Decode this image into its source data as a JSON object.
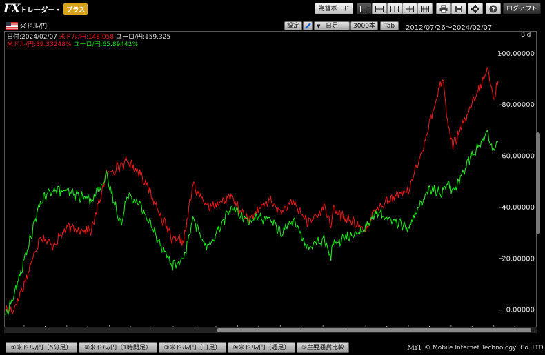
{
  "app": {
    "logo_fx": "FX",
    "logo_trader": "トレーダー・",
    "logo_plus": "プラス"
  },
  "toolbar": {
    "rate_board": "為替ボード",
    "logout": "ログアウト",
    "icons": [
      "layout-single-icon",
      "layout-rows-icon",
      "layout-columns-icon",
      "layout-quad-icon",
      "layout-grid-icon",
      "print-icon",
      "save-icon",
      "settings-icon",
      "help-icon"
    ]
  },
  "panel": {
    "pair": "米ドル/円",
    "settings_button": "設定",
    "interval": "日足",
    "bars": "3000本",
    "tab_button": "Tab",
    "date_range": "2012/07/26～2024/02/07"
  },
  "info": {
    "date_label": "日付:2024/02/07",
    "usd_price_label": "米ドル/円:148.058",
    "eur_price_label": "ユーロ/円:159.325",
    "usd_change_label": "米ドル/円:89.33248%",
    "eur_change_label": "ユーロ/円:65.89442%",
    "price_type": "Bid"
  },
  "chart_data": {
    "type": "line",
    "title": "",
    "ylabel": "",
    "y_unit": "%",
    "ylim": [
      -6,
      108
    ],
    "y_ticks": [
      "100.00000",
      "80.00000",
      "60.00000",
      "40.00000",
      "20.00000",
      "0.00000"
    ],
    "x_ticks": [
      "2013年",
      "2014年",
      "2015年",
      "2016年",
      "2017年",
      "2018年",
      "2019年",
      "2020年",
      "2021年",
      "2022年",
      "2023年",
      "2024年"
    ],
    "x_start": "2012-07-26",
    "x_end": "2024-02-07",
    "series": [
      {
        "name": "米ドル/円",
        "color": "#e01818",
        "x": [
          "2012-07-26",
          "2012-10-01",
          "2013-01-01",
          "2013-05-20",
          "2013-09-01",
          "2014-01-02",
          "2014-08-01",
          "2014-12-05",
          "2015-06-05",
          "2015-10-01",
          "2016-06-24",
          "2016-09-27",
          "2016-12-15",
          "2017-04-17",
          "2017-11-06",
          "2018-03-26",
          "2018-10-03",
          "2019-01-03",
          "2019-04-24",
          "2019-08-26",
          "2020-01-17",
          "2020-03-09",
          "2020-03-24",
          "2020-12-31",
          "2021-03-31",
          "2021-12-31",
          "2022-03-28",
          "2022-06-30",
          "2022-10-21",
          "2022-11-30",
          "2023-01-16",
          "2023-05-31",
          "2023-11-13",
          "2023-12-28",
          "2024-02-07"
        ],
        "values": [
          0,
          0,
          10,
          29,
          25,
          32,
          31,
          53,
          58,
          53,
          27,
          27,
          49,
          40,
          44,
          35,
          43,
          38,
          42,
          34,
          40,
          33,
          39,
          31,
          40,
          47,
          57,
          73,
          91,
          74,
          64,
          77,
          94,
          82,
          89.33
        ]
      },
      {
        "name": "ユーロ/円",
        "color": "#1ee01e",
        "x": [
          "2012-07-26",
          "2012-10-01",
          "2013-01-01",
          "2013-05-20",
          "2013-09-01",
          "2014-01-02",
          "2014-08-01",
          "2014-12-05",
          "2015-04-14",
          "2015-06-05",
          "2015-10-01",
          "2016-06-24",
          "2016-09-27",
          "2016-12-15",
          "2017-04-17",
          "2017-11-06",
          "2018-03-26",
          "2018-10-03",
          "2019-01-03",
          "2019-04-24",
          "2019-08-26",
          "2020-01-17",
          "2020-03-09",
          "2020-03-24",
          "2020-12-31",
          "2021-03-31",
          "2021-12-31",
          "2022-03-28",
          "2022-06-30",
          "2022-10-21",
          "2022-11-30",
          "2023-01-16",
          "2023-05-31",
          "2023-11-13",
          "2023-12-28",
          "2024-02-07"
        ],
        "values": [
          -2,
          5,
          19,
          42,
          47,
          46,
          43,
          52,
          33,
          46,
          40,
          17,
          20,
          35,
          24,
          40,
          35,
          36,
          30,
          35,
          24,
          28,
          21,
          26,
          32,
          38,
          32,
          40,
          47,
          46,
          50,
          46,
          58,
          69,
          62,
          65.89
        ]
      }
    ]
  },
  "scroll": {
    "thumb_start_fraction": 0.4,
    "thumb_end_fraction": 0.99
  },
  "bottom_tabs": [
    "①米ドル/円（5分足）",
    "②米ドル/円（1時間足）",
    "③米ドル/円（日足）",
    "④米ドル/円（週足）",
    "⑤主要通貨比較"
  ],
  "footer": {
    "logo": "MiT",
    "copyright": "© Mobile Internet Technology, Co.,LTD."
  },
  "colors": {
    "usd": "#e01818",
    "eur": "#1ee01e",
    "background": "#000000",
    "plus_badge": "#d9a21b"
  }
}
